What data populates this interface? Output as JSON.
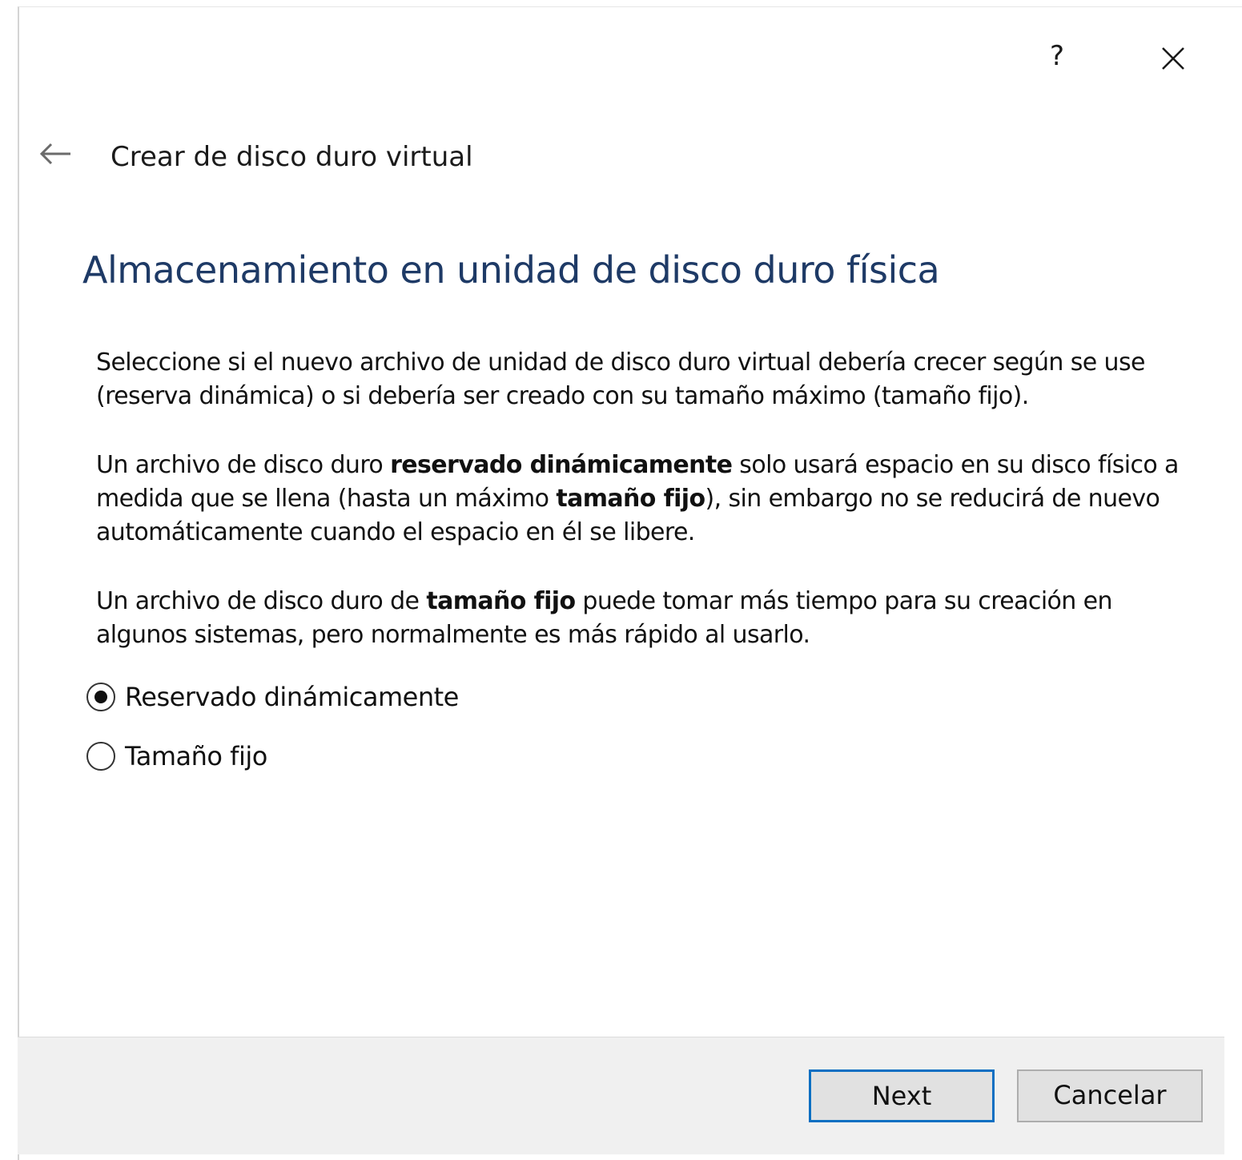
{
  "window": {
    "help_label": "?",
    "close_icon": "close-icon"
  },
  "header": {
    "back_icon": "back-arrow-icon",
    "wizard_title": "Crear de disco duro virtual"
  },
  "page": {
    "heading": "Almacenamiento en unidad de disco duro física",
    "paragraph1": "Seleccione si el nuevo archivo de unidad de disco duro virtual debería crecer según se use (reserva dinámica) o si debería ser creado con su tamaño máximo (tamaño fijo).",
    "paragraph2": {
      "part1": "Un archivo de disco duro ",
      "bold1": "reservado dinámicamente",
      "part2": " solo usará espacio en su disco físico a medida que se llena (hasta un máximo ",
      "bold2": "tamaño fijo",
      "part3": "), sin embargo no se reducirá de nuevo automáticamente cuando el espacio en él se libere."
    },
    "paragraph3": {
      "part1": "Un archivo de disco duro de ",
      "bold1": "tamaño fijo",
      "part2": " puede tomar más tiempo para su creación en algunos sistemas, pero normalmente es más rápido al usarlo."
    }
  },
  "options": [
    {
      "label": "Reservado dinámicamente",
      "selected": true
    },
    {
      "label": "Tamaño fijo",
      "selected": false
    }
  ],
  "footer": {
    "next_label": "Next",
    "cancel_label": "Cancelar"
  },
  "colors": {
    "heading": "#1e3a66",
    "default_button_border": "#0b6fc2",
    "footer_background": "#f0f0f0"
  }
}
